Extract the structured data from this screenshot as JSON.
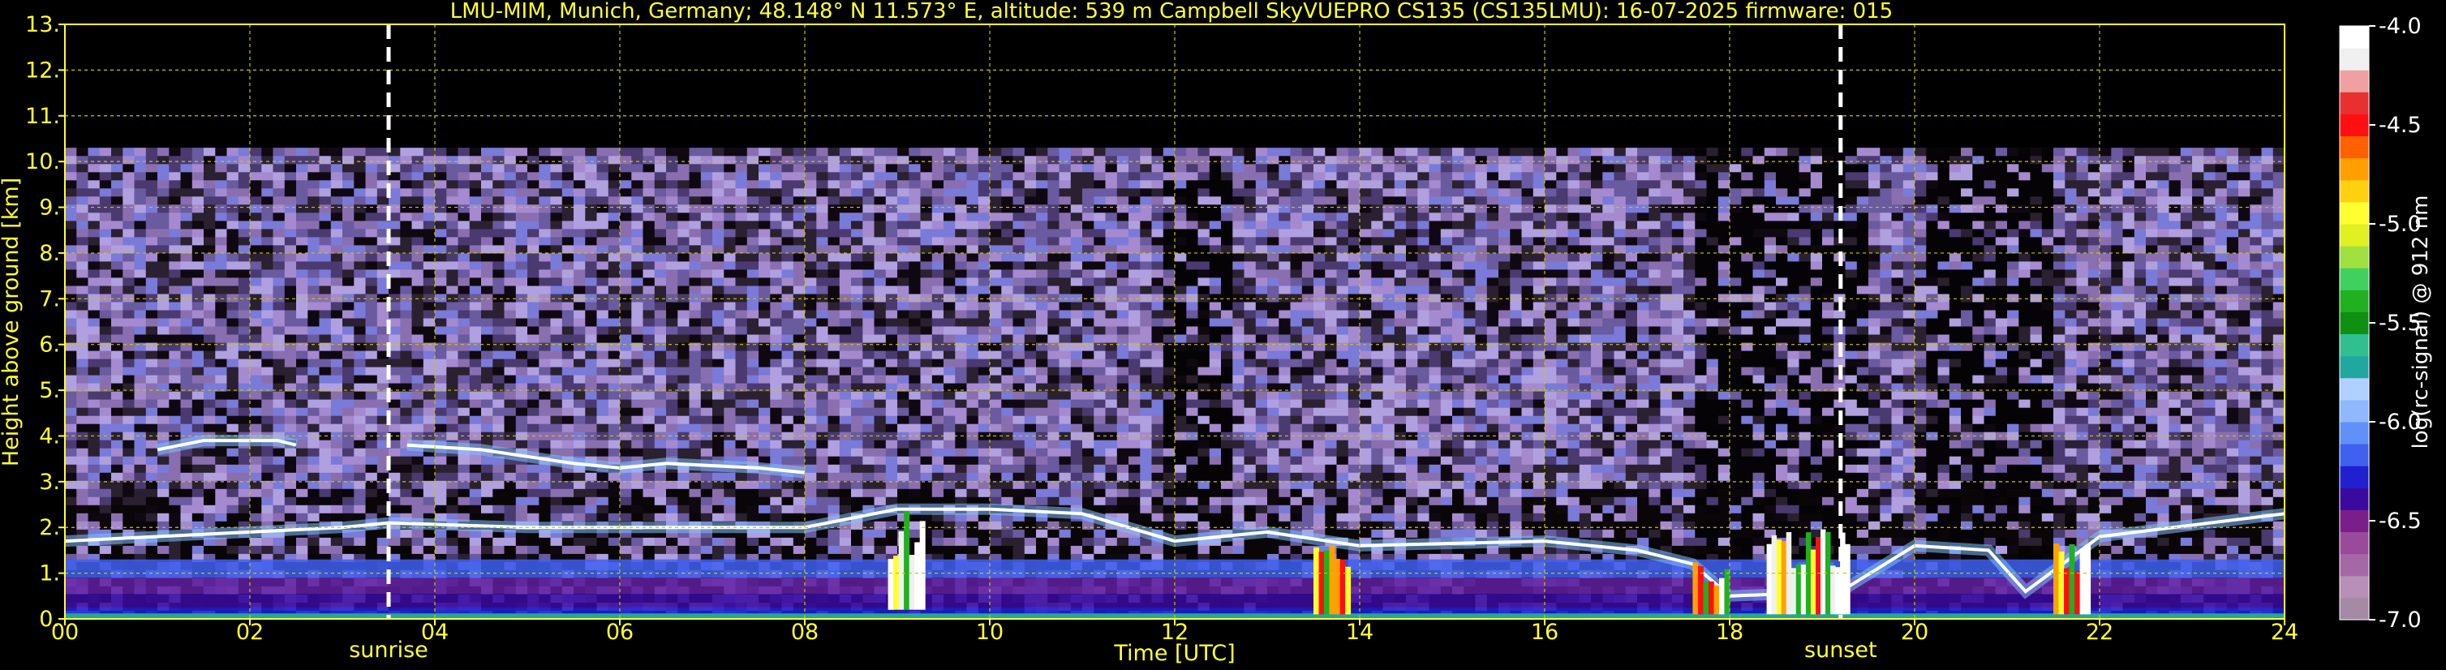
{
  "chart_data": {
    "type": "heatmap",
    "title": "LMU-MIM, Munich, Germany; 48.148° N 11.573° E, altitude: 539 m     Campbell SkyVUEPRO CS135 (CS135LMU): 16-07-2025     firmware: 015",
    "xlabel": "Time [UTC]",
    "ylabel": "Height above ground [km]",
    "xlim": [
      0,
      24
    ],
    "ylim": [
      0,
      13
    ],
    "xticks": [
      "00",
      "02",
      "04",
      "06",
      "08",
      "10",
      "12",
      "14",
      "16",
      "18",
      "20",
      "22",
      "24"
    ],
    "xtick_values": [
      0,
      2,
      4,
      6,
      8,
      10,
      12,
      14,
      16,
      18,
      20,
      22,
      24
    ],
    "yticks": [
      "0.",
      "1.",
      "2.",
      "3.",
      "4.",
      "5.",
      "6.",
      "7.",
      "8.",
      "9.",
      "10.",
      "11.",
      "12.",
      "13."
    ],
    "ytick_values": [
      0,
      1,
      2,
      3,
      4,
      5,
      6,
      7,
      8,
      9,
      10,
      11,
      12,
      13
    ],
    "grid": true,
    "data_top_km": 10.3,
    "markers": [
      {
        "label": "sunrise",
        "time_h": 3.5
      },
      {
        "label": "sunset",
        "time_h": 19.2
      }
    ],
    "colorbar": {
      "label": "log(rc-signal) @ 912 nm",
      "range": [
        -7.0,
        -4.0
      ],
      "ticks": [
        "-4.0",
        "-4.5",
        "-5.0",
        "-5.5",
        "-6.0",
        "-6.5",
        "-7.0"
      ],
      "tick_values": [
        -4.0,
        -4.5,
        -5.0,
        -5.5,
        -6.0,
        -6.5,
        -7.0
      ],
      "colors": [
        "#a58aa5",
        "#b78fb7",
        "#a667a6",
        "#9a4a9a",
        "#7a1f8a",
        "#3a0aa0",
        "#2020d0",
        "#4060f0",
        "#6090f8",
        "#90b8ff",
        "#b0d0ff",
        "#20a8a0",
        "#30c090",
        "#109010",
        "#20b020",
        "#40d060",
        "#a0e040",
        "#e0f020",
        "#ffff30",
        "#ffd010",
        "#ffa000",
        "#ff6000",
        "#ff1010",
        "#e83030",
        "#f0a0a0",
        "#f0f0f0",
        "#ffffff"
      ]
    },
    "layers": [
      {
        "name": "boundary layer",
        "points": [
          [
            0,
            1.7
          ],
          [
            1,
            1.8
          ],
          [
            2,
            1.9
          ],
          [
            3,
            2.0
          ],
          [
            3.5,
            2.1
          ],
          [
            5,
            2.0
          ],
          [
            8,
            2.0
          ],
          [
            9,
            2.4
          ],
          [
            10,
            2.4
          ],
          [
            11,
            2.3
          ],
          [
            12,
            1.7
          ],
          [
            13,
            1.9
          ],
          [
            14,
            1.6
          ],
          [
            16,
            1.7
          ],
          [
            17,
            1.5
          ],
          [
            17.6,
            1.2
          ],
          [
            18,
            0.5
          ],
          [
            19.2,
            0.6
          ],
          [
            20,
            1.6
          ],
          [
            20.8,
            1.5
          ],
          [
            21.2,
            0.6
          ],
          [
            22,
            1.8
          ],
          [
            24,
            2.3
          ]
        ]
      },
      {
        "name": "aerosol layer",
        "points": [
          [
            3.7,
            3.8
          ],
          [
            4.5,
            3.7
          ],
          [
            5.5,
            3.4
          ],
          [
            6,
            3.3
          ],
          [
            6.5,
            3.4
          ],
          [
            7.5,
            3.3
          ],
          [
            8,
            3.2
          ]
        ]
      },
      {
        "name": "cloud layer",
        "points": [
          [
            1,
            3.7
          ],
          [
            1.5,
            3.9
          ],
          [
            2.3,
            3.9
          ],
          [
            2.5,
            3.8
          ]
        ]
      }
    ],
    "hot_spots": [
      {
        "x0": 8.9,
        "x1": 9.3,
        "y0": 0.2,
        "y1": 2.4
      },
      {
        "x0": 13.5,
        "x1": 13.9,
        "y0": 0.1,
        "y1": 1.7
      },
      {
        "x0": 17.6,
        "x1": 18.0,
        "y0": 0.1,
        "y1": 1.3
      },
      {
        "x0": 18.4,
        "x1": 19.3,
        "y0": 0.1,
        "y1": 2.0
      },
      {
        "x0": 21.5,
        "x1": 21.9,
        "y0": 0.1,
        "y1": 1.8
      }
    ]
  }
}
